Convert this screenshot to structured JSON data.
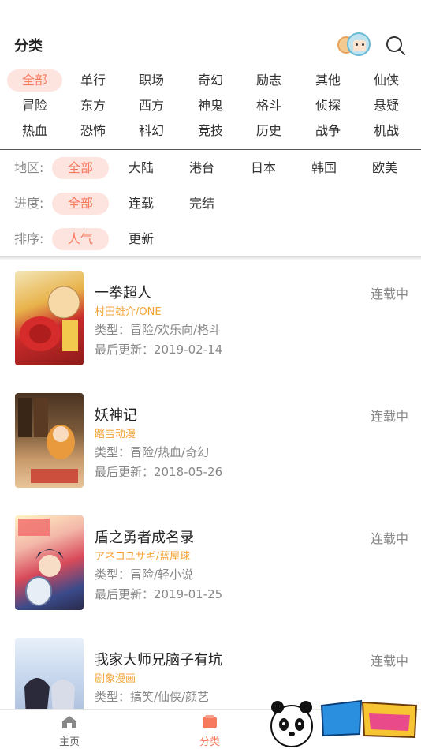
{
  "header": {
    "title": "分类"
  },
  "genres": [
    {
      "label": "全部",
      "active": true
    },
    {
      "label": "单行"
    },
    {
      "label": "职场"
    },
    {
      "label": "奇幻"
    },
    {
      "label": "励志"
    },
    {
      "label": "其他"
    },
    {
      "label": "仙侠"
    },
    {
      "label": "冒险"
    },
    {
      "label": "东方"
    },
    {
      "label": "西方"
    },
    {
      "label": "神鬼"
    },
    {
      "label": "格斗"
    },
    {
      "label": "侦探"
    },
    {
      "label": "悬疑"
    },
    {
      "label": "热血"
    },
    {
      "label": "恐怖"
    },
    {
      "label": "科幻"
    },
    {
      "label": "竞技"
    },
    {
      "label": "历史"
    },
    {
      "label": "战争"
    },
    {
      "label": "机战"
    }
  ],
  "filters": {
    "region": {
      "label": "地区:",
      "options": [
        "全部",
        "大陆",
        "港台",
        "日本",
        "韩国",
        "欧美"
      ]
    },
    "progress": {
      "label": "进度:",
      "options": [
        "全部",
        "连载",
        "完结"
      ]
    },
    "sort": {
      "label": "排序:",
      "options": [
        "人气",
        "更新"
      ]
    }
  },
  "comics": [
    {
      "title": "一拳超人",
      "author": "村田雄介/ONE",
      "genre": "类型：冒险/欢乐向/格斗",
      "updated": "最后更新：2019-02-14",
      "status": "连载中"
    },
    {
      "title": "妖神记",
      "author": "踏雪动漫",
      "genre": "类型：冒险/热血/奇幻",
      "updated": "最后更新：2018-05-26",
      "status": "连载中"
    },
    {
      "title": "盾之勇者成名录",
      "author": "アネコユサギ/蓝屋球",
      "genre": "类型：冒险/轻小说",
      "updated": "最后更新：2019-01-25",
      "status": "连载中"
    },
    {
      "title": "我家大师兄脑子有坑",
      "author": "剧象漫画",
      "genre": "类型：搞笑/仙侠/颜艺",
      "updated": "",
      "status": "连载中"
    }
  ],
  "tabbar": {
    "home": "主页",
    "category": "分类"
  },
  "colors": {
    "accent": "#f77a5f",
    "accent_bg": "#fde4df",
    "author": "#f5a234",
    "muted": "#888888"
  }
}
